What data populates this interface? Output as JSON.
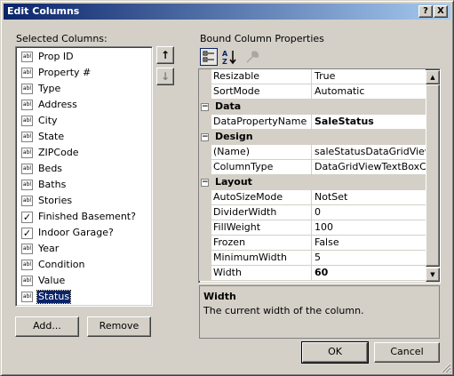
{
  "window": {
    "title": "Edit Columns",
    "help_button": "?",
    "close_button": "X"
  },
  "left": {
    "label": "Selected Columns:",
    "icon_text": "abl",
    "items": [
      {
        "label": "Prop ID",
        "kind": "text",
        "selected": false
      },
      {
        "label": "Property #",
        "kind": "text",
        "selected": false
      },
      {
        "label": "Type",
        "kind": "text",
        "selected": false
      },
      {
        "label": "Address",
        "kind": "text",
        "selected": false
      },
      {
        "label": "City",
        "kind": "text",
        "selected": false
      },
      {
        "label": "State",
        "kind": "text",
        "selected": false
      },
      {
        "label": "ZIPCode",
        "kind": "text",
        "selected": false
      },
      {
        "label": "Beds",
        "kind": "text",
        "selected": false
      },
      {
        "label": "Baths",
        "kind": "text",
        "selected": false
      },
      {
        "label": "Stories",
        "kind": "text",
        "selected": false
      },
      {
        "label": "Finished Basement?",
        "kind": "check",
        "selected": false
      },
      {
        "label": "Indoor Garage?",
        "kind": "check",
        "selected": false
      },
      {
        "label": "Year",
        "kind": "text",
        "selected": false
      },
      {
        "label": "Condition",
        "kind": "text",
        "selected": false
      },
      {
        "label": "Value",
        "kind": "text",
        "selected": false
      },
      {
        "label": "Status",
        "kind": "text",
        "selected": true
      }
    ],
    "move_up": "↑",
    "move_down": "↓",
    "add_button": "Add...",
    "remove_button": "Remove"
  },
  "right": {
    "label": "Bound Column Properties",
    "toolbar": {
      "categorized_icon": "categorized-icon",
      "alphabetical_icon": "alphabetical-icon",
      "property_pages_icon": "property-pages-icon"
    },
    "rows": [
      {
        "type": "prop",
        "name": "Resizable",
        "value": "True",
        "bold": false
      },
      {
        "type": "prop",
        "name": "SortMode",
        "value": "Automatic",
        "bold": false
      },
      {
        "type": "cat",
        "name": "Data",
        "sign": "−"
      },
      {
        "type": "prop",
        "name": "DataPropertyName",
        "value": "SaleStatus",
        "bold": true
      },
      {
        "type": "cat",
        "name": "Design",
        "sign": "−"
      },
      {
        "type": "prop",
        "name": "(Name)",
        "value": "saleStatusDataGridViewTe",
        "bold": false
      },
      {
        "type": "prop",
        "name": "ColumnType",
        "value": "DataGridViewTextBoxColu",
        "bold": false
      },
      {
        "type": "cat",
        "name": "Layout",
        "sign": "−"
      },
      {
        "type": "prop",
        "name": "AutoSizeMode",
        "value": "NotSet",
        "bold": false
      },
      {
        "type": "prop",
        "name": "DividerWidth",
        "value": "0",
        "bold": false
      },
      {
        "type": "prop",
        "name": "FillWeight",
        "value": "100",
        "bold": false
      },
      {
        "type": "prop",
        "name": "Frozen",
        "value": "False",
        "bold": false
      },
      {
        "type": "prop",
        "name": "MinimumWidth",
        "value": "5",
        "bold": false
      },
      {
        "type": "prop",
        "name": "Width",
        "value": "60",
        "bold": true
      }
    ],
    "scroll_up": "▲",
    "scroll_down": "▼",
    "help_title": "Width",
    "help_text": "The current width of the column."
  },
  "footer": {
    "ok_button": "OK",
    "cancel_button": "Cancel"
  },
  "colors": {
    "face": "#d4d0c8",
    "title_start": "#0a246a",
    "title_end": "#a6caf0",
    "selection": "#0a246a"
  }
}
